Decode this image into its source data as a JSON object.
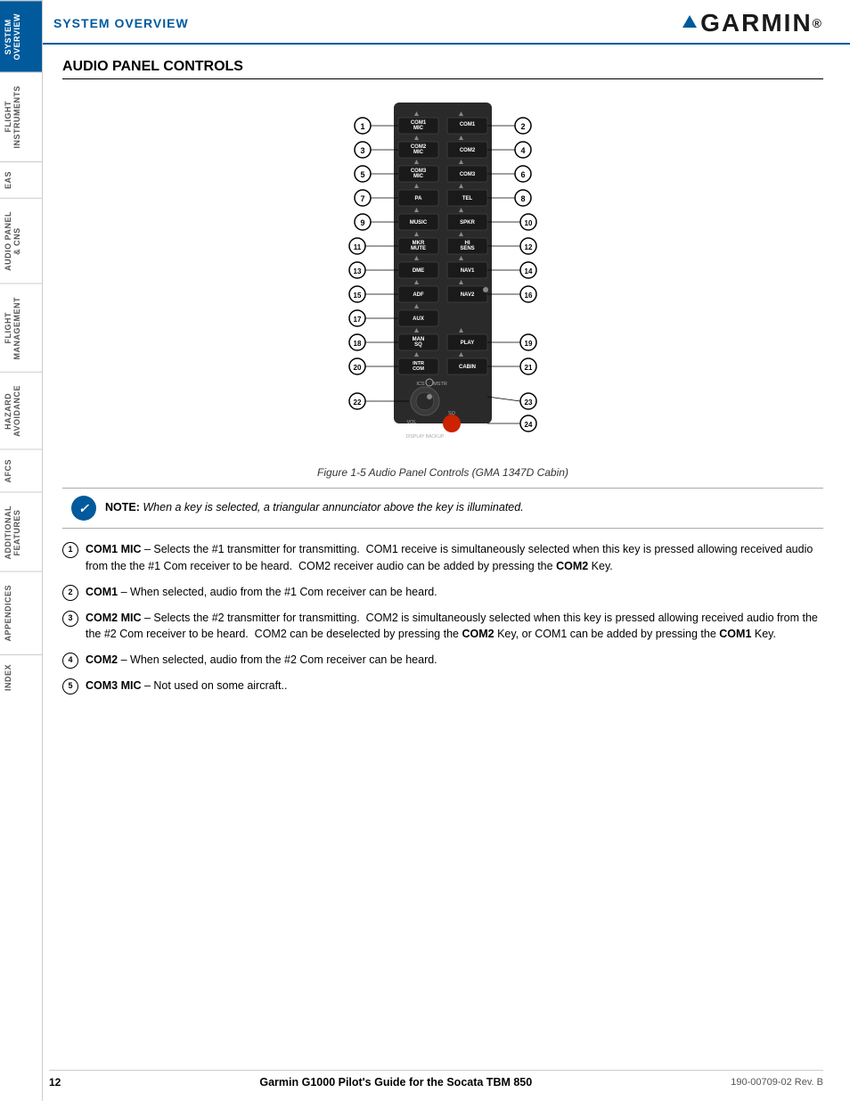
{
  "header": {
    "title": "SYSTEM OVERVIEW",
    "logo_text": "GARMIN",
    "logo_reg": "®"
  },
  "sidebar": {
    "tabs": [
      {
        "label": "SYSTEM\nOVERVIEW",
        "active": true
      },
      {
        "label": "FLIGHT\nINSTRUMENTS",
        "active": false
      },
      {
        "label": "EAS",
        "active": false
      },
      {
        "label": "AUDIO PANEL\n& CNS",
        "active": false
      },
      {
        "label": "FLIGHT\nMANAGEMENT",
        "active": false
      },
      {
        "label": "HAZARD\nAVOIDANCE",
        "active": false
      },
      {
        "label": "AFCS",
        "active": false
      },
      {
        "label": "ADDITIONAL\nFEATURES",
        "active": false
      },
      {
        "label": "APPENDICES",
        "active": false
      },
      {
        "label": "INDEX",
        "active": false
      }
    ]
  },
  "section_title": "AUDIO PANEL CONTROLS",
  "figure_caption": "Figure 1-5  Audio Panel Controls (GMA 1347D Cabin)",
  "note": {
    "prefix": "NOTE:",
    "text": " When a key is selected, a triangular annunciator above the key is illuminated."
  },
  "descriptions": [
    {
      "num": "1",
      "label": "COM1 MIC",
      "dash": "–",
      "text": "Selects the #1 transmitter for transmitting.  COM1 receive is simultaneously selected when this key is pressed allowing received audio from the the #1 Com receiver to be heard.  COM2 receiver audio can be added by pressing the ",
      "bold_word": "COM2",
      "text2": " Key."
    },
    {
      "num": "2",
      "label": "COM1",
      "dash": "–",
      "text": "When selected, audio from the #1 Com receiver can be heard.",
      "bold_word": "",
      "text2": ""
    },
    {
      "num": "3",
      "label": "COM2 MIC",
      "dash": "–",
      "text": "Selects the #2 transmitter for transmitting.  COM2 is simultaneously selected when this key is pressed allowing received audio from the the #2 Com receiver to be heard.  COM2 can be deselected by pressing the ",
      "bold_word": "COM2",
      "text2": " Key, or COM1 can be added by pressing the ",
      "bold_word2": "COM1",
      "text3": " Key."
    },
    {
      "num": "4",
      "label": "COM2",
      "dash": "–",
      "text": "When selected, audio from the #2 Com receiver can be heard.",
      "bold_word": "",
      "text2": ""
    },
    {
      "num": "5",
      "label": "COM3 MIC",
      "dash": "–",
      "text": "Not used on some aircraft..",
      "bold_word": "",
      "text2": ""
    }
  ],
  "footer": {
    "page": "12",
    "title": "Garmin G1000 Pilot's Guide for the Socata TBM 850",
    "doc": "190-00709-02  Rev. B"
  }
}
